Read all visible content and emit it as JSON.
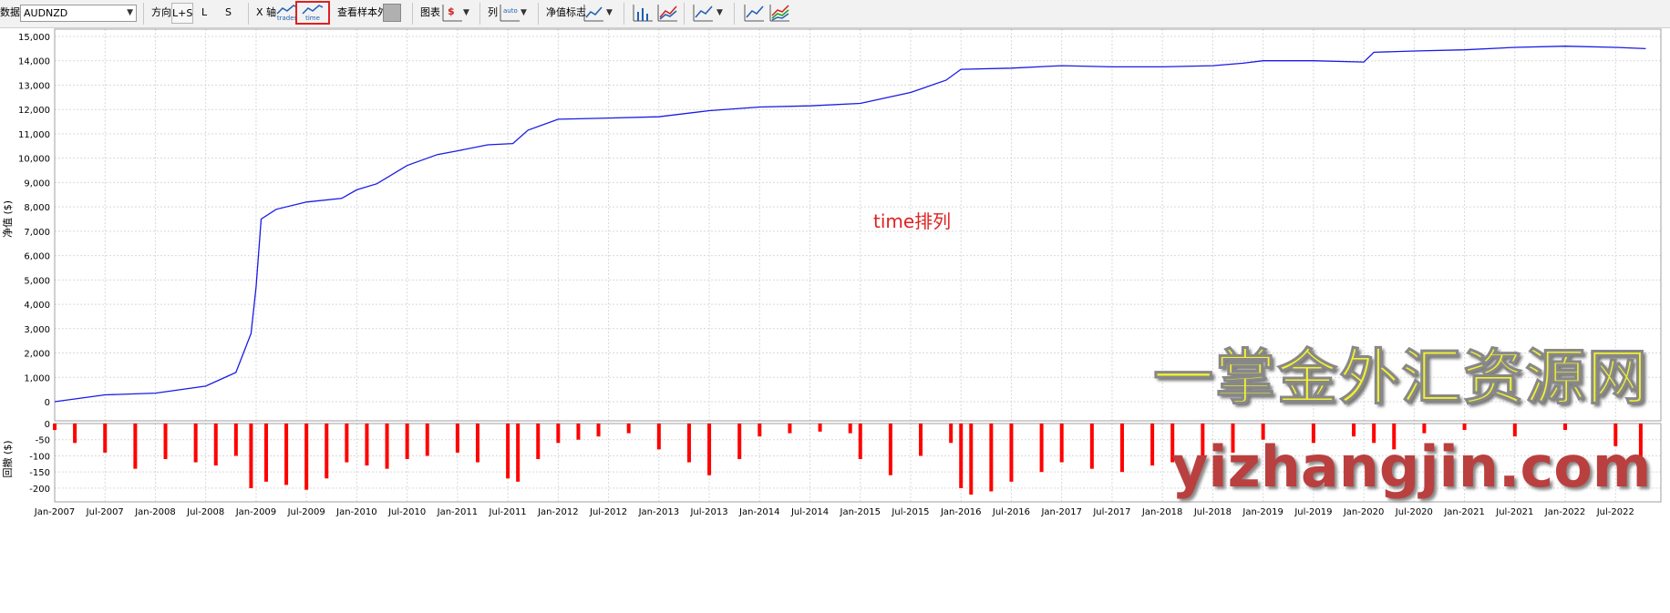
{
  "toolbar": {
    "data_label": "数据",
    "symbol": "AUDNZD",
    "direction_label": "方向",
    "dir_ls": "L+S",
    "dir_l": "L",
    "dir_s": "S",
    "xaxis_label": "X 轴",
    "xaxis_trades": "trades",
    "xaxis_time": "time",
    "view_oos_label": "查看样本外",
    "chart_label": "图表",
    "chart_icon_text": "$",
    "column_label": "列",
    "column_icon_text": "auto",
    "equity_label": "净值标志"
  },
  "annotation": "time排列",
  "watermark": {
    "cn": "一掌金外汇资源网",
    "url": "yizhangjin.com"
  },
  "colors": {
    "equity_line": "#1a1ae6",
    "drawdown_fill": "#ff0000",
    "grid": "#d9d9d9",
    "highlight_box": "#e02020"
  },
  "chart_data": [
    {
      "type": "line",
      "ylabel": "净值 ($)",
      "ylim": [
        0,
        15000
      ],
      "yticks": [
        "0",
        "1,000",
        "2,000",
        "3,000",
        "4,000",
        "5,000",
        "6,000",
        "7,000",
        "8,000",
        "9,000",
        "10,000",
        "11,000",
        "12,000",
        "13,000",
        "14,000",
        "15,000"
      ],
      "grid": true,
      "series": [
        {
          "x": [
            2007.0,
            2007.5,
            2008.0,
            2008.5,
            2008.8,
            2008.95,
            2009.0,
            2009.05,
            2009.2,
            2009.5,
            2009.85,
            2010.0,
            2010.2,
            2010.5,
            2010.8,
            2011.0,
            2011.3,
            2011.55,
            2011.7,
            2012.0,
            2012.5,
            2013.0,
            2013.5,
            2014.0,
            2014.5,
            2015.0,
            2015.5,
            2015.85,
            2016.0,
            2016.5,
            2017.0,
            2017.5,
            2018.0,
            2018.5,
            2018.8,
            2019.0,
            2019.5,
            2020.0,
            2020.1,
            2020.5,
            2021.0,
            2021.5,
            2022.0,
            2022.5,
            2022.8
          ],
          "values": [
            0,
            280,
            350,
            640,
            1200,
            2800,
            4700,
            7500,
            7900,
            8200,
            8350,
            8700,
            8950,
            9700,
            10150,
            10300,
            10550,
            10600,
            11150,
            11600,
            11650,
            11700,
            11950,
            12100,
            12150,
            12250,
            12700,
            13200,
            13650,
            13700,
            13800,
            13750,
            13750,
            13800,
            13900,
            14000,
            14000,
            13950,
            14350,
            14400,
            14450,
            14550,
            14600,
            14550,
            14500
          ]
        }
      ]
    },
    {
      "type": "bar",
      "ylabel": "回撤 ($)",
      "ylim": [
        -220,
        0
      ],
      "yticks": [
        "0",
        "-50",
        "-100",
        "-150",
        "-200"
      ],
      "xticks": [
        "Jan-2007",
        "Jul-2007",
        "Jan-2008",
        "Jul-2008",
        "Jan-2009",
        "Jul-2009",
        "Jan-2010",
        "Jul-2010",
        "Jan-2011",
        "Jul-2011",
        "Jan-2012",
        "Jul-2012",
        "Jan-2013",
        "Jul-2013",
        "Jan-2014",
        "Jul-2014",
        "Jan-2015",
        "Jul-2015",
        "Jan-2016",
        "Jul-2016",
        "Jan-2017",
        "Jul-2017",
        "Jan-2018",
        "Jul-2018",
        "Jan-2019",
        "Jul-2019",
        "Jan-2020",
        "Jul-2020",
        "Jan-2021",
        "Jul-2021",
        "Jan-2022",
        "Jul-2022"
      ],
      "series": [
        {
          "x": [
            2007.0,
            2007.2,
            2007.5,
            2007.8,
            2008.1,
            2008.4,
            2008.6,
            2008.8,
            2008.95,
            2009.1,
            2009.3,
            2009.5,
            2009.7,
            2009.9,
            2010.1,
            2010.3,
            2010.5,
            2010.7,
            2011.0,
            2011.2,
            2011.5,
            2011.6,
            2011.8,
            2012.0,
            2012.2,
            2012.4,
            2012.7,
            2013.0,
            2013.3,
            2013.5,
            2013.8,
            2014.0,
            2014.3,
            2014.6,
            2014.9,
            2015.0,
            2015.3,
            2015.6,
            2015.9,
            2016.0,
            2016.1,
            2016.3,
            2016.5,
            2016.8,
            2017.0,
            2017.3,
            2017.6,
            2017.9,
            2018.1,
            2018.4,
            2018.7,
            2019.0,
            2019.5,
            2019.9,
            2020.1,
            2020.3,
            2020.6,
            2021.0,
            2021.5,
            2022.0,
            2022.5,
            2022.75
          ],
          "values": [
            -20,
            -60,
            -90,
            -140,
            -110,
            -120,
            -130,
            -100,
            -200,
            -180,
            -190,
            -205,
            -170,
            -120,
            -130,
            -140,
            -110,
            -100,
            -90,
            -120,
            -170,
            -180,
            -110,
            -60,
            -50,
            -40,
            -30,
            -80,
            -120,
            -160,
            -110,
            -40,
            -30,
            -25,
            -30,
            -110,
            -160,
            -100,
            -60,
            -200,
            -220,
            -210,
            -180,
            -150,
            -120,
            -140,
            -150,
            -130,
            -120,
            -100,
            -90,
            -50,
            -60,
            -40,
            -60,
            -80,
            -30,
            -20,
            -40,
            -20,
            -70,
            -120
          ]
        }
      ]
    }
  ]
}
